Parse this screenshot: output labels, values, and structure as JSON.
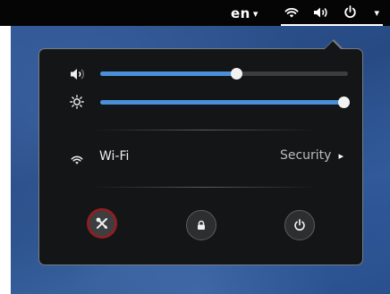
{
  "topbar": {
    "language": "en",
    "language_caret": "▾",
    "indicators": [
      "wifi-icon",
      "volume-icon",
      "power-icon"
    ],
    "power_caret": "▾"
  },
  "panel": {
    "volume": {
      "icon": "volume-icon",
      "level": 0.55
    },
    "brightness": {
      "icon": "brightness-icon",
      "level": 1.0
    },
    "wifi": {
      "icon": "wifi-icon",
      "label": "Wi-Fi",
      "status": "Security",
      "arrow": "▸"
    },
    "buttons": [
      {
        "name": "settings-button",
        "icon": "settings-icon",
        "active": true
      },
      {
        "name": "lock-button",
        "icon": "lock-icon",
        "active": false
      },
      {
        "name": "power-off-button",
        "icon": "power-icon",
        "active": false
      }
    ]
  },
  "colors": {
    "accent": "#4a90d9",
    "panel_bg": "#131516",
    "topbar_bg": "#050505",
    "active_ring": "#8e1f22"
  }
}
